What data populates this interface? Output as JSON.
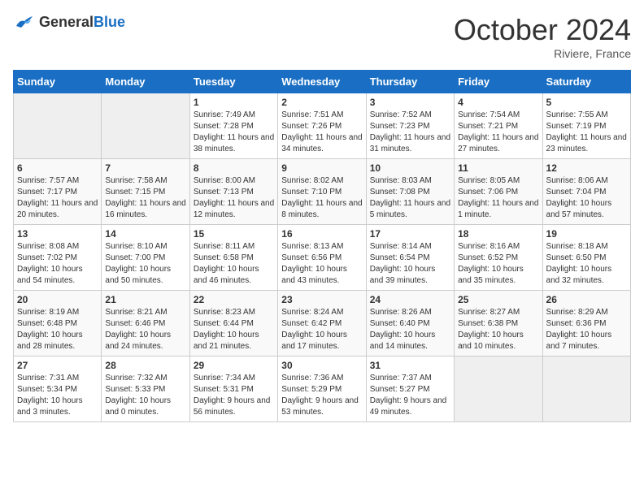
{
  "header": {
    "logo_general": "General",
    "logo_blue": "Blue",
    "month_title": "October 2024",
    "location": "Riviere, France"
  },
  "days_of_week": [
    "Sunday",
    "Monday",
    "Tuesday",
    "Wednesday",
    "Thursday",
    "Friday",
    "Saturday"
  ],
  "weeks": [
    [
      {
        "num": "",
        "empty": true
      },
      {
        "num": "",
        "empty": true
      },
      {
        "num": "1",
        "sunrise": "Sunrise: 7:49 AM",
        "sunset": "Sunset: 7:28 PM",
        "daylight": "Daylight: 11 hours and 38 minutes."
      },
      {
        "num": "2",
        "sunrise": "Sunrise: 7:51 AM",
        "sunset": "Sunset: 7:26 PM",
        "daylight": "Daylight: 11 hours and 34 minutes."
      },
      {
        "num": "3",
        "sunrise": "Sunrise: 7:52 AM",
        "sunset": "Sunset: 7:23 PM",
        "daylight": "Daylight: 11 hours and 31 minutes."
      },
      {
        "num": "4",
        "sunrise": "Sunrise: 7:54 AM",
        "sunset": "Sunset: 7:21 PM",
        "daylight": "Daylight: 11 hours and 27 minutes."
      },
      {
        "num": "5",
        "sunrise": "Sunrise: 7:55 AM",
        "sunset": "Sunset: 7:19 PM",
        "daylight": "Daylight: 11 hours and 23 minutes."
      }
    ],
    [
      {
        "num": "6",
        "sunrise": "Sunrise: 7:57 AM",
        "sunset": "Sunset: 7:17 PM",
        "daylight": "Daylight: 11 hours and 20 minutes."
      },
      {
        "num": "7",
        "sunrise": "Sunrise: 7:58 AM",
        "sunset": "Sunset: 7:15 PM",
        "daylight": "Daylight: 11 hours and 16 minutes."
      },
      {
        "num": "8",
        "sunrise": "Sunrise: 8:00 AM",
        "sunset": "Sunset: 7:13 PM",
        "daylight": "Daylight: 11 hours and 12 minutes."
      },
      {
        "num": "9",
        "sunrise": "Sunrise: 8:02 AM",
        "sunset": "Sunset: 7:10 PM",
        "daylight": "Daylight: 11 hours and 8 minutes."
      },
      {
        "num": "10",
        "sunrise": "Sunrise: 8:03 AM",
        "sunset": "Sunset: 7:08 PM",
        "daylight": "Daylight: 11 hours and 5 minutes."
      },
      {
        "num": "11",
        "sunrise": "Sunrise: 8:05 AM",
        "sunset": "Sunset: 7:06 PM",
        "daylight": "Daylight: 11 hours and 1 minute."
      },
      {
        "num": "12",
        "sunrise": "Sunrise: 8:06 AM",
        "sunset": "Sunset: 7:04 PM",
        "daylight": "Daylight: 10 hours and 57 minutes."
      }
    ],
    [
      {
        "num": "13",
        "sunrise": "Sunrise: 8:08 AM",
        "sunset": "Sunset: 7:02 PM",
        "daylight": "Daylight: 10 hours and 54 minutes."
      },
      {
        "num": "14",
        "sunrise": "Sunrise: 8:10 AM",
        "sunset": "Sunset: 7:00 PM",
        "daylight": "Daylight: 10 hours and 50 minutes."
      },
      {
        "num": "15",
        "sunrise": "Sunrise: 8:11 AM",
        "sunset": "Sunset: 6:58 PM",
        "daylight": "Daylight: 10 hours and 46 minutes."
      },
      {
        "num": "16",
        "sunrise": "Sunrise: 8:13 AM",
        "sunset": "Sunset: 6:56 PM",
        "daylight": "Daylight: 10 hours and 43 minutes."
      },
      {
        "num": "17",
        "sunrise": "Sunrise: 8:14 AM",
        "sunset": "Sunset: 6:54 PM",
        "daylight": "Daylight: 10 hours and 39 minutes."
      },
      {
        "num": "18",
        "sunrise": "Sunrise: 8:16 AM",
        "sunset": "Sunset: 6:52 PM",
        "daylight": "Daylight: 10 hours and 35 minutes."
      },
      {
        "num": "19",
        "sunrise": "Sunrise: 8:18 AM",
        "sunset": "Sunset: 6:50 PM",
        "daylight": "Daylight: 10 hours and 32 minutes."
      }
    ],
    [
      {
        "num": "20",
        "sunrise": "Sunrise: 8:19 AM",
        "sunset": "Sunset: 6:48 PM",
        "daylight": "Daylight: 10 hours and 28 minutes."
      },
      {
        "num": "21",
        "sunrise": "Sunrise: 8:21 AM",
        "sunset": "Sunset: 6:46 PM",
        "daylight": "Daylight: 10 hours and 24 minutes."
      },
      {
        "num": "22",
        "sunrise": "Sunrise: 8:23 AM",
        "sunset": "Sunset: 6:44 PM",
        "daylight": "Daylight: 10 hours and 21 minutes."
      },
      {
        "num": "23",
        "sunrise": "Sunrise: 8:24 AM",
        "sunset": "Sunset: 6:42 PM",
        "daylight": "Daylight: 10 hours and 17 minutes."
      },
      {
        "num": "24",
        "sunrise": "Sunrise: 8:26 AM",
        "sunset": "Sunset: 6:40 PM",
        "daylight": "Daylight: 10 hours and 14 minutes."
      },
      {
        "num": "25",
        "sunrise": "Sunrise: 8:27 AM",
        "sunset": "Sunset: 6:38 PM",
        "daylight": "Daylight: 10 hours and 10 minutes."
      },
      {
        "num": "26",
        "sunrise": "Sunrise: 8:29 AM",
        "sunset": "Sunset: 6:36 PM",
        "daylight": "Daylight: 10 hours and 7 minutes."
      }
    ],
    [
      {
        "num": "27",
        "sunrise": "Sunrise: 7:31 AM",
        "sunset": "Sunset: 5:34 PM",
        "daylight": "Daylight: 10 hours and 3 minutes."
      },
      {
        "num": "28",
        "sunrise": "Sunrise: 7:32 AM",
        "sunset": "Sunset: 5:33 PM",
        "daylight": "Daylight: 10 hours and 0 minutes."
      },
      {
        "num": "29",
        "sunrise": "Sunrise: 7:34 AM",
        "sunset": "Sunset: 5:31 PM",
        "daylight": "Daylight: 9 hours and 56 minutes."
      },
      {
        "num": "30",
        "sunrise": "Sunrise: 7:36 AM",
        "sunset": "Sunset: 5:29 PM",
        "daylight": "Daylight: 9 hours and 53 minutes."
      },
      {
        "num": "31",
        "sunrise": "Sunrise: 7:37 AM",
        "sunset": "Sunset: 5:27 PM",
        "daylight": "Daylight: 9 hours and 49 minutes."
      },
      {
        "num": "",
        "empty": true
      },
      {
        "num": "",
        "empty": true
      }
    ]
  ]
}
